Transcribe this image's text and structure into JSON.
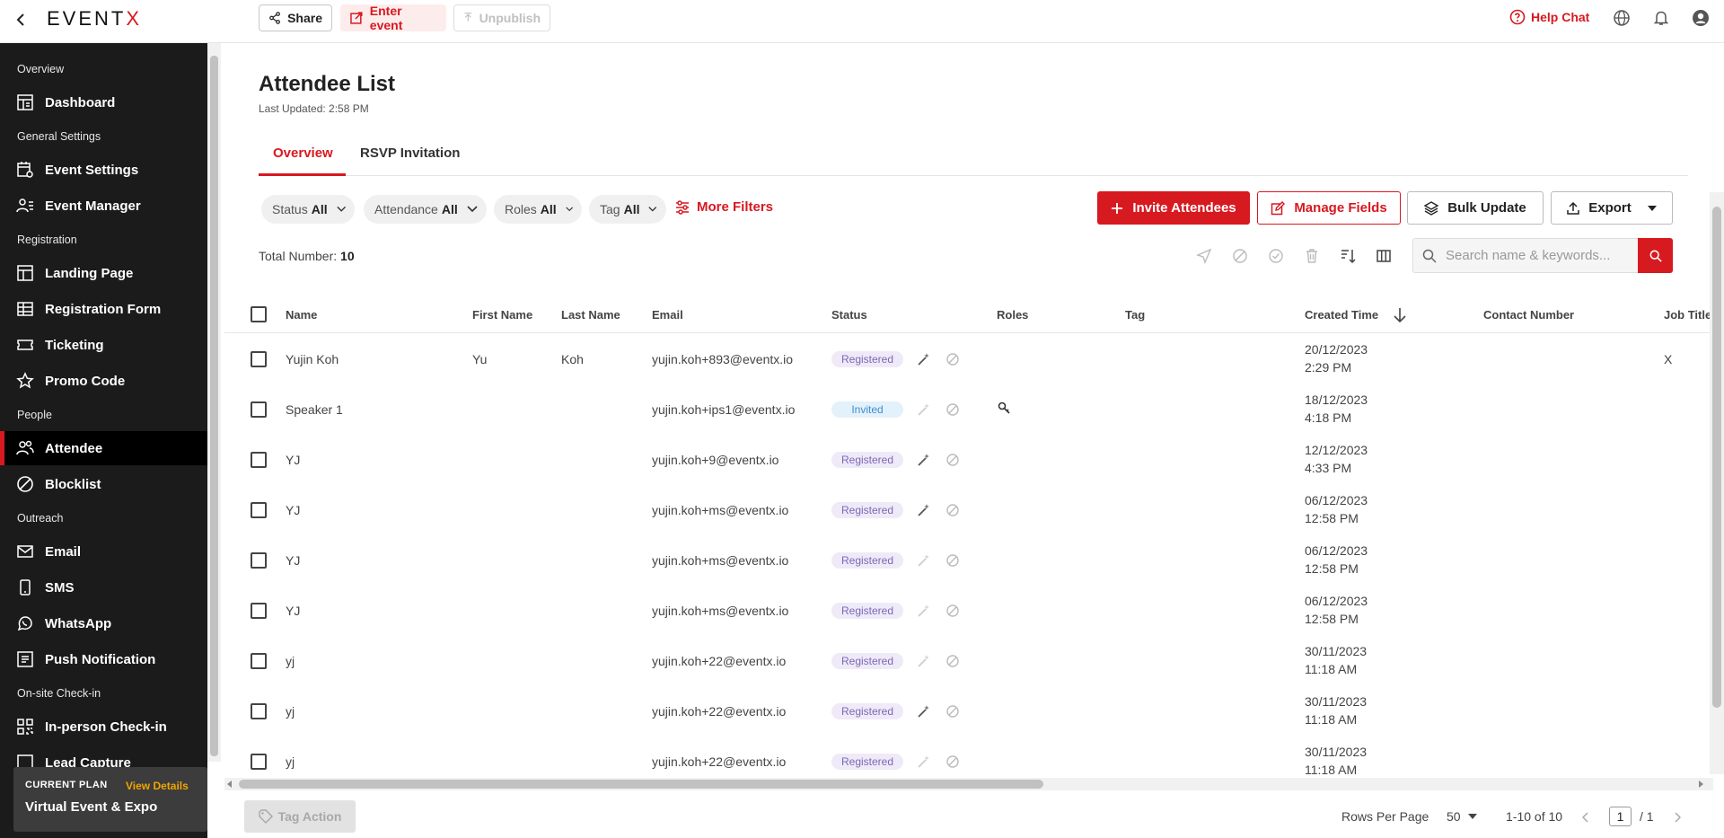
{
  "topbar": {
    "logo": "EVENTX",
    "share": "Share",
    "enter_event": "Enter event",
    "unpublish": "Unpublish",
    "help_chat": "Help Chat"
  },
  "sidebar": {
    "sections": [
      "Overview",
      "General Settings",
      "Registration",
      "People",
      "Outreach",
      "On-site Check-in"
    ],
    "items": [
      {
        "label": "Dashboard",
        "icon": "dashboard-icon"
      },
      {
        "label": "Event Settings",
        "icon": "event-settings-icon"
      },
      {
        "label": "Event Manager",
        "icon": "event-manager-icon"
      },
      {
        "label": "Landing Page",
        "icon": "landing-page-icon"
      },
      {
        "label": "Registration Form",
        "icon": "table-icon"
      },
      {
        "label": "Ticketing",
        "icon": "ticket-icon"
      },
      {
        "label": "Promo Code",
        "icon": "star-icon"
      },
      {
        "label": "Attendee",
        "icon": "people-icon",
        "active": true
      },
      {
        "label": "Blocklist",
        "icon": "block-icon"
      },
      {
        "label": "Email",
        "icon": "mail-icon"
      },
      {
        "label": "SMS",
        "icon": "phone-icon"
      },
      {
        "label": "WhatsApp",
        "icon": "whatsapp-icon"
      },
      {
        "label": "Push Notification",
        "icon": "push-icon"
      },
      {
        "label": "In-person Check-in",
        "icon": "qr-icon"
      },
      {
        "label": "Lead Capture",
        "icon": "lead-icon"
      }
    ],
    "plan": {
      "label": "CURRENT PLAN",
      "view": "View Details",
      "name": "Virtual Event & Expo"
    }
  },
  "page": {
    "title": "Attendee List",
    "updated": "Last Updated: 2:58 PM",
    "tabs": [
      "Overview",
      "RSVP Invitation"
    ]
  },
  "filters": [
    {
      "label": "Status",
      "value": "All"
    },
    {
      "label": "Attendance",
      "value": "All"
    },
    {
      "label": "Roles",
      "value": "All"
    },
    {
      "label": "Tag",
      "value": "All"
    }
  ],
  "more_filters": "More Filters",
  "actions": {
    "invite": "Invite Attendees",
    "manage": "Manage Fields",
    "bulk": "Bulk Update",
    "export": "Export"
  },
  "total": {
    "label": "Total Number:",
    "value": "10"
  },
  "search": {
    "placeholder": "Search name & keywords..."
  },
  "table": {
    "columns": [
      "Name",
      "First Name",
      "Last Name",
      "Email",
      "Status",
      "Roles",
      "Tag",
      "Created Time",
      "Contact Number",
      "Job Title"
    ],
    "rows": [
      {
        "name": "Yujin Koh",
        "first": "Yu",
        "last": "Koh",
        "email": "yujin.koh+893@eventx.io",
        "status": "Registered",
        "role_icon": false,
        "date": "20/12/2023",
        "time": "2:29 PM",
        "job": "X",
        "wand_active": true
      },
      {
        "name": "Speaker 1",
        "first": "",
        "last": "",
        "email": "yujin.koh+ips1@eventx.io",
        "status": "Invited",
        "role_icon": true,
        "date": "18/12/2023",
        "time": "4:18 PM",
        "job": "",
        "wand_active": false
      },
      {
        "name": "YJ",
        "first": "",
        "last": "",
        "email": "yujin.koh+9@eventx.io",
        "status": "Registered",
        "role_icon": false,
        "date": "12/12/2023",
        "time": "4:33 PM",
        "job": "",
        "wand_active": true
      },
      {
        "name": "YJ",
        "first": "",
        "last": "",
        "email": "yujin.koh+ms@eventx.io",
        "status": "Registered",
        "role_icon": false,
        "date": "06/12/2023",
        "time": "12:58 PM",
        "job": "",
        "wand_active": true
      },
      {
        "name": "YJ",
        "first": "",
        "last": "",
        "email": "yujin.koh+ms@eventx.io",
        "status": "Registered",
        "role_icon": false,
        "date": "06/12/2023",
        "time": "12:58 PM",
        "job": "",
        "wand_active": false
      },
      {
        "name": "YJ",
        "first": "",
        "last": "",
        "email": "yujin.koh+ms@eventx.io",
        "status": "Registered",
        "role_icon": false,
        "date": "06/12/2023",
        "time": "12:58 PM",
        "job": "",
        "wand_active": false
      },
      {
        "name": "yj",
        "first": "",
        "last": "",
        "email": "yujin.koh+22@eventx.io",
        "status": "Registered",
        "role_icon": false,
        "date": "30/11/2023",
        "time": "11:18 AM",
        "job": "",
        "wand_active": false
      },
      {
        "name": "yj",
        "first": "",
        "last": "",
        "email": "yujin.koh+22@eventx.io",
        "status": "Registered",
        "role_icon": false,
        "date": "30/11/2023",
        "time": "11:18 AM",
        "job": "",
        "wand_active": true
      },
      {
        "name": "yj",
        "first": "",
        "last": "",
        "email": "yujin.koh+22@eventx.io",
        "status": "Registered",
        "role_icon": false,
        "date": "30/11/2023",
        "time": "11:18 AM",
        "job": "",
        "wand_active": false
      }
    ]
  },
  "footer": {
    "tag_action": "Tag Action",
    "rows_per_page_label": "Rows Per Page",
    "rows_per_page": "50",
    "range": "1-10 of 10",
    "page": "1",
    "pages": "/ 1"
  },
  "colors": {
    "accent": "#d71920",
    "sidebar": "#1b1b1b",
    "registered": "#7b68b5",
    "invited": "#3b8fd0"
  }
}
